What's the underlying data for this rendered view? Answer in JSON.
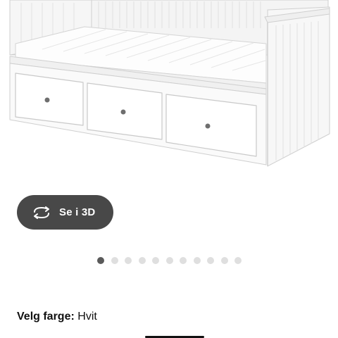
{
  "product": {
    "image_alt": "HEMNES daybed with 3 drawers, white",
    "color": "#ffffff"
  },
  "view_3d": {
    "label": "Se i 3D",
    "icon": "rotate-3d-icon"
  },
  "carousel": {
    "total": 11,
    "active_index": 0
  },
  "color_selector": {
    "label": "Velg farge:",
    "value": "Hvit"
  }
}
